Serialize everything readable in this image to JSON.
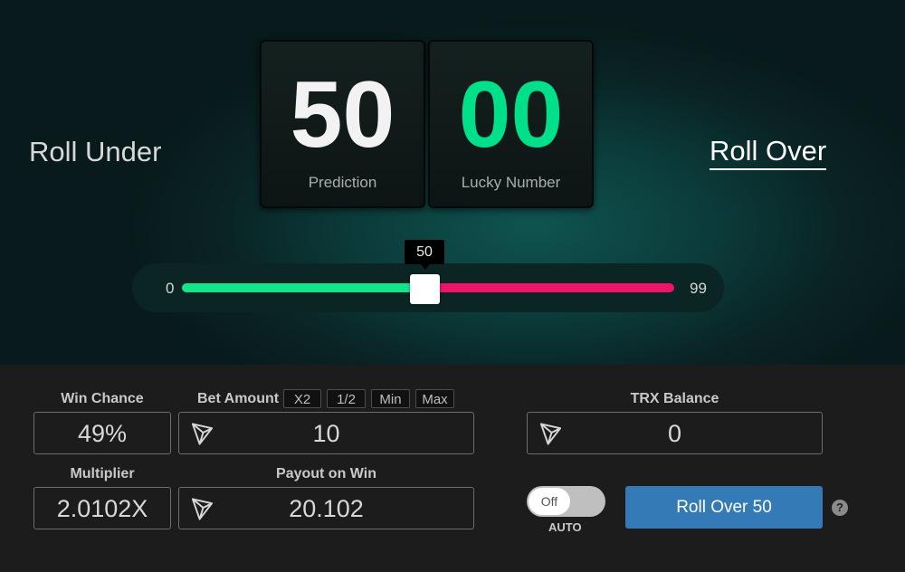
{
  "header": {
    "roll_under_label": "Roll Under",
    "roll_over_label": "Roll Over",
    "prediction": {
      "value": "50",
      "label": "Prediction"
    },
    "lucky_number": {
      "value": "00",
      "label": "Lucky Number"
    }
  },
  "slider": {
    "min": "0",
    "max": "99",
    "value": "50",
    "tooltip": "50",
    "colors": {
      "under": "#10e68a",
      "over": "#f0136a"
    }
  },
  "bet_panel": {
    "win_chance_label": "Win Chance",
    "win_chance_value": "49%",
    "bet_amount_label": "Bet Amount",
    "bet_amount_value": "10",
    "bet_buttons": [
      "X2",
      "1/2",
      "Min",
      "Max"
    ],
    "multiplier_label": "Multiplier",
    "multiplier_value": "2.0102X",
    "payout_label": "Payout on Win",
    "payout_value": "20.102",
    "trx_balance_label": "TRX Balance",
    "trx_balance_value": "0",
    "currency_icon": "tron-icon"
  },
  "controls": {
    "auto_toggle_state": "Off",
    "auto_label": "AUTO",
    "roll_button_label": "Roll Over 50",
    "help_icon": "question-circle-icon",
    "accent": "#337ab7"
  }
}
